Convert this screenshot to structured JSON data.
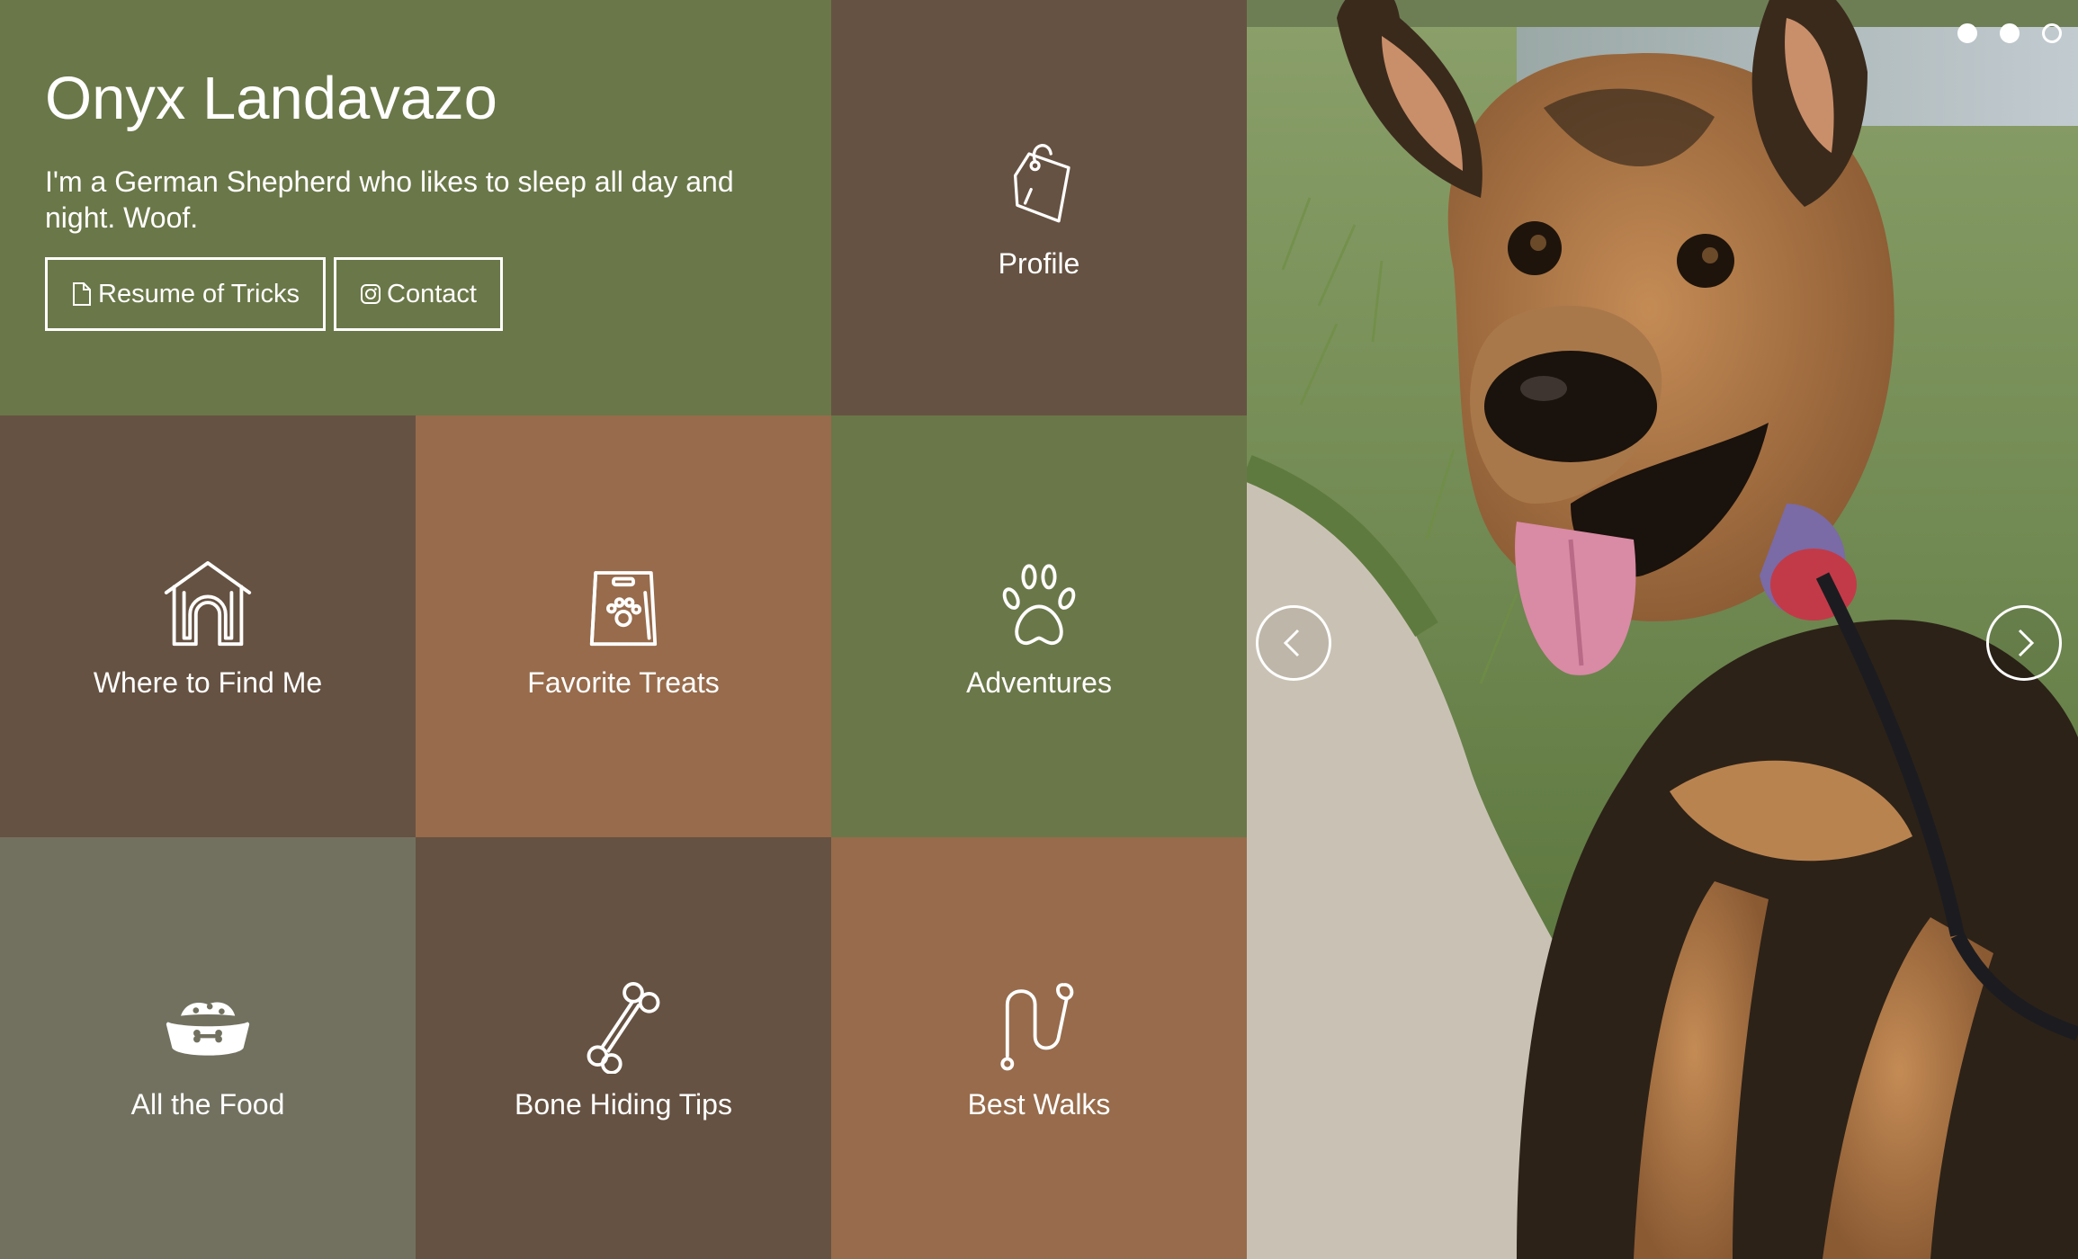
{
  "hero": {
    "name": "Onyx Landavazo",
    "bio": "I'm a German Shepherd who likes to sleep all day and night. Woof.",
    "resume_label": "Resume of Tricks",
    "contact_label": "Contact",
    "resume_icon": "file-icon",
    "contact_icon": "instagram-icon"
  },
  "tiles": [
    {
      "label": "Profile",
      "icon": "tag-icon",
      "color": "#665242"
    },
    {
      "label": "Where to Find Me",
      "icon": "house-icon",
      "color": "#665242"
    },
    {
      "label": "Favorite Treats",
      "icon": "treat-bag-icon",
      "color": "#976b4b"
    },
    {
      "label": "Adventures",
      "icon": "paw-icon",
      "color": "#6a7748"
    },
    {
      "label": "All the Food",
      "icon": "food-bowl-icon",
      "color": "#727160"
    },
    {
      "label": "Bone Hiding Tips",
      "icon": "bone-icon",
      "color": "#665242"
    },
    {
      "label": "Best Walks",
      "icon": "leash-icon",
      "color": "#976b4b"
    }
  ],
  "colors": {
    "olive": "#6a7748",
    "brown": "#665242",
    "copper": "#976b4b",
    "gray_olive": "#727160"
  },
  "carousel": {
    "photo": "german-shepherd-photo",
    "prev_icon": "chevron-left-icon",
    "next_icon": "chevron-right-icon",
    "active_slide": 2,
    "slide_count": 3
  }
}
